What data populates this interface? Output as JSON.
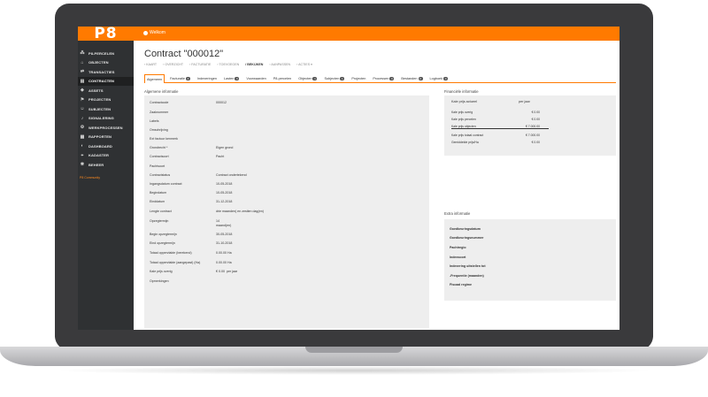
{
  "app": {
    "logo": "P8",
    "welcome": "Welkom"
  },
  "sidebar": {
    "items": [
      {
        "label": "P8-PERCELEN",
        "icon": "parcels-icon"
      },
      {
        "label": "OBJECTEN",
        "icon": "home-icon"
      },
      {
        "label": "TRANSACTIES",
        "icon": "transactions-icon"
      },
      {
        "label": "CONTRACTEN",
        "icon": "contract-icon",
        "active": true
      },
      {
        "label": "ASSETS",
        "icon": "assets-icon"
      },
      {
        "label": "PROJECTEN",
        "icon": "projects-icon"
      },
      {
        "label": "SUBJECTEN",
        "icon": "people-icon"
      },
      {
        "label": "SIGNALERING",
        "icon": "bell-icon"
      },
      {
        "label": "WERKPROCESSEN",
        "icon": "workflow-icon"
      },
      {
        "label": "RAPPORTEN",
        "icon": "report-icon"
      },
      {
        "label": "DASHBOARD",
        "icon": "dashboard-icon"
      },
      {
        "label": "KADASTER",
        "icon": "kadaster-icon"
      },
      {
        "label": "BEHEER",
        "icon": "gear-icon"
      }
    ],
    "footer_link": "P8 Community"
  },
  "main": {
    "title": "Contract \"000012\"",
    "actions": [
      {
        "label": "› KAART",
        "on": false
      },
      {
        "label": "› OVERZICHT",
        "on": false
      },
      {
        "label": "› FACTURATIE",
        "on": false
      },
      {
        "label": "› TOEVOEGEN",
        "on": false
      },
      {
        "label": "/ BEKIJKEN",
        "on": true
      },
      {
        "label": "› AANPASSEN",
        "on": false
      },
      {
        "label": "› ACTIES ▾",
        "on": false
      }
    ],
    "tabs": [
      {
        "label": "Algemeen",
        "active": true
      },
      {
        "label": "Facturatie",
        "badge": "2"
      },
      {
        "label": "Indexeringen"
      },
      {
        "label": "Lasten",
        "badge": "0"
      },
      {
        "label": "Voorwaarden"
      },
      {
        "label": "P8-percelen"
      },
      {
        "label": "Objecten",
        "badge": "1"
      },
      {
        "label": "Subjecten",
        "badge": "1"
      },
      {
        "label": "Projecten"
      },
      {
        "label": "Processen",
        "badge": "0"
      },
      {
        "label": "Bestanden",
        "badge": "0"
      },
      {
        "label": "Logboek",
        "badge": "0"
      }
    ],
    "general": {
      "title": "Algemene informatie",
      "rows": [
        {
          "label": "Contractcode",
          "value": "000012"
        },
        {
          "label": "Zaaknummer",
          "value": ""
        },
        {
          "label": "Labels",
          "value": ""
        },
        {
          "label": "Omschrijving",
          "value": ""
        },
        {
          "label": "Ext factuur kenmerk",
          "value": ""
        },
        {
          "label": "Grondrecht *",
          "value": "Eigen grond"
        },
        {
          "label": "Contractsoort",
          "value": "Pacht"
        },
        {
          "label": "Pachtsoort",
          "value": ""
        },
        {
          "label": "Contractstatus",
          "value": "Contract ondertekend"
        },
        {
          "label": "Ingangsdatum contract",
          "value": "10-05-2018"
        },
        {
          "label": "Begindatum",
          "value": "10-05-2018"
        },
        {
          "label": "Einddatum",
          "value": "31-12-2018"
        },
        {
          "label": "Lengte contract",
          "value": "drie maanden( en zestien dag(en)"
        },
        {
          "label": "Opzegtermijn",
          "value": "14\nmaand(en)"
        },
        {
          "label": "Begin opzegtermijn",
          "value": "30-05-2018"
        },
        {
          "label": "Eind opzegtermijn",
          "value": "31-10-2018"
        },
        {
          "label": "Totaal oppervlakte (berekend)",
          "value": "0.00.00 Ha"
        },
        {
          "label": "Totaal oppervlakte (aangepast) (Ha)",
          "value": "0.00.00 Ha"
        },
        {
          "label": "Kale prijs overig",
          "value": "€ 0.00  per jaar"
        },
        {
          "label": "Opmerkingen",
          "value": ""
        }
      ]
    },
    "financial": {
      "title": "Financiële informatie",
      "col1": "Kale prijs actueel",
      "col2": "per jaar",
      "rows": [
        {
          "label": "Kale prijs overig",
          "value": "€ 0.00"
        },
        {
          "label": "Kale prijs percelen",
          "value": "€ 0.00"
        },
        {
          "label": "Kale prijs objecten",
          "value": "€ 7.000.00"
        },
        {
          "label": "Kale prijs totaal contract",
          "value": "€ 7.000.00"
        },
        {
          "label": "Gemiddelde prijs/Ha",
          "value": "€ 0.00"
        }
      ]
    },
    "extra": {
      "title": "Extra informatie",
      "rows": [
        "Goedkeuringsdatum",
        "Goedkeuringsnummer",
        "Pachtregio",
        "Indexsoort",
        "Indexering uitstellen tot",
        "-Frequentie (maanden)",
        "Fiscaal regime"
      ]
    }
  }
}
